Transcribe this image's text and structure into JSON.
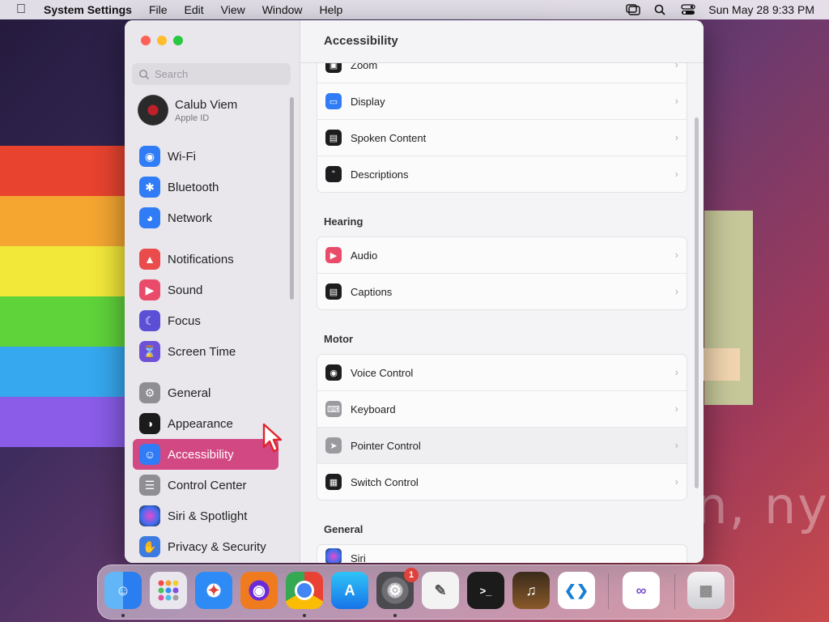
{
  "menubar": {
    "app_name": "System Settings",
    "menus": [
      "File",
      "Edit",
      "View",
      "Window",
      "Help"
    ],
    "clock": "Sun May 28  9:33 PM"
  },
  "wallpaper_text": "on, ny",
  "window": {
    "title": "Accessibility",
    "search_placeholder": "Search"
  },
  "account": {
    "name": "Calub Viem",
    "subtitle": "Apple ID"
  },
  "sidebar": {
    "items": [
      {
        "label": "Wi-Fi",
        "icon": "wifi-icon",
        "color": "#2f7cf6"
      },
      {
        "label": "Bluetooth",
        "icon": "bluetooth-icon",
        "color": "#2f7cf6"
      },
      {
        "label": "Network",
        "icon": "globe-icon",
        "color": "#2f7cf6"
      },
      {
        "label": "Notifications",
        "icon": "bell-icon",
        "color": "#ea4b4b"
      },
      {
        "label": "Sound",
        "icon": "speaker-icon",
        "color": "#ea4b6a"
      },
      {
        "label": "Focus",
        "icon": "moon-icon",
        "color": "#5b4fd6"
      },
      {
        "label": "Screen Time",
        "icon": "hourglass-icon",
        "color": "#6d52d8"
      },
      {
        "label": "General",
        "icon": "gear-icon",
        "color": "#8e8e93"
      },
      {
        "label": "Appearance",
        "icon": "appearance-icon",
        "color": "#1b1b1b"
      },
      {
        "label": "Accessibility",
        "icon": "accessibility-icon",
        "color": "#2f7cf6"
      },
      {
        "label": "Control Center",
        "icon": "toggles-icon",
        "color": "#8e8e93"
      },
      {
        "label": "Siri & Spotlight",
        "icon": "siri-icon",
        "color": "#6b3fb5"
      },
      {
        "label": "Privacy & Security",
        "icon": "hand-icon",
        "color": "#3d7be0"
      }
    ],
    "selected": "Accessibility"
  },
  "vision_rows": [
    {
      "label": "Zoom",
      "icon": "zoom-icon",
      "color": "#1d1d1f"
    },
    {
      "label": "Display",
      "icon": "display-icon",
      "color": "#2f7cf6"
    },
    {
      "label": "Spoken Content",
      "icon": "speech-bubble-icon",
      "color": "#1d1d1f"
    },
    {
      "label": "Descriptions",
      "icon": "quote-bubble-icon",
      "color": "#1d1d1f"
    }
  ],
  "sections": {
    "hearing": "Hearing",
    "motor": "Motor",
    "general": "General"
  },
  "hearing_rows": [
    {
      "label": "Audio",
      "icon": "speaker-icon",
      "color": "#ea4b6a"
    },
    {
      "label": "Captions",
      "icon": "captions-icon",
      "color": "#1d1d1f"
    }
  ],
  "motor_rows": [
    {
      "label": "Voice Control",
      "icon": "voice-control-icon",
      "color": "#1d1d1f"
    },
    {
      "label": "Keyboard",
      "icon": "keyboard-icon",
      "color": "#9a9a9f"
    },
    {
      "label": "Pointer Control",
      "icon": "pointer-icon",
      "color": "#9a9a9f"
    },
    {
      "label": "Switch Control",
      "icon": "grid-icon",
      "color": "#1d1d1f"
    }
  ],
  "general_rows": [
    {
      "label": "Siri",
      "icon": "siri-icon",
      "color": "#6b3fb5"
    }
  ],
  "dock": {
    "apps": [
      "Finder",
      "Launchpad",
      "Safari",
      "Firefox",
      "Chrome",
      "App Store",
      "System Settings",
      "TextEdit",
      "Terminal",
      "GarageBand",
      "Visual Studio Code",
      "Visual Studio",
      "Trash"
    ],
    "system_settings_badge": "1"
  }
}
